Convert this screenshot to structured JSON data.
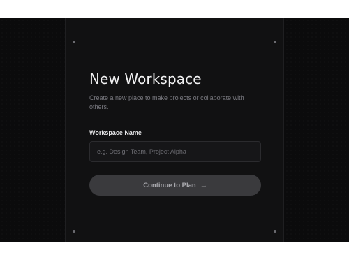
{
  "page": {
    "title": "New Workspace",
    "subtitle": "Create a new place to make projects or collaborate with others."
  },
  "form": {
    "workspace_name_label": "Workspace Name",
    "workspace_name_placeholder": "e.g. Design Team, Project Alpha",
    "workspace_name_value": ""
  },
  "actions": {
    "continue_label": "Continue to Plan",
    "continue_icon": "arrow-right-icon",
    "continue_arrow_glyph": "→"
  },
  "colors": {
    "background": "#0b0b0c",
    "panel": "#111112",
    "button": "#3a3a3d",
    "button_text": "#a9a9ae"
  }
}
